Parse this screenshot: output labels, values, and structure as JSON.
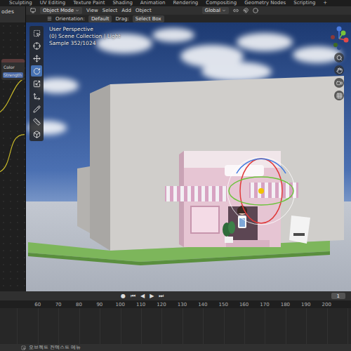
{
  "workspace_tabs": [
    {
      "label": "Sculpting",
      "selected": false
    },
    {
      "label": "UV Editing",
      "selected": false
    },
    {
      "label": "Texture Paint",
      "selected": false
    },
    {
      "label": "Shading",
      "selected": false
    },
    {
      "label": "Animation",
      "selected": false
    },
    {
      "label": "Rendering",
      "selected": false
    },
    {
      "label": "Compositing",
      "selected": false
    },
    {
      "label": "Geometry Nodes",
      "selected": false
    },
    {
      "label": "Scripting",
      "selected": false
    }
  ],
  "add_tab": "+",
  "node_editor": {
    "header": "odes",
    "fields": [
      "Color",
      "Strength"
    ]
  },
  "viewport_header": {
    "mode": "Object Mode",
    "menus": [
      "View",
      "Select",
      "Add",
      "Object"
    ],
    "transform": "Global"
  },
  "tool_settings": {
    "orientation_label": "Orientation:",
    "orientation": "Default",
    "drag_label": "Drag:",
    "drag": "Select Box"
  },
  "viewport_info": [
    "User Perspective",
    "(0) Scene Collection | Light",
    "Sample 352/1024"
  ],
  "tools": [
    {
      "selected": false
    },
    {
      "selected": false
    },
    {
      "selected": false
    },
    {
      "selected": true
    },
    {
      "selected": false
    },
    {
      "selected": false
    },
    {
      "selected": false
    },
    {
      "selected": false
    },
    {
      "selected": false
    }
  ],
  "timeline": {
    "controls": [
      "●",
      "⏮",
      "◀",
      "▶",
      "⏭"
    ],
    "frame": "1",
    "ruler": [
      "60",
      "70",
      "80",
      "90",
      "100",
      "110",
      "120",
      "130",
      "140",
      "150",
      "160",
      "170",
      "180",
      "190",
      "200"
    ]
  },
  "status_bar": {
    "text": "오브젝트 컨텍스트 메뉴"
  }
}
